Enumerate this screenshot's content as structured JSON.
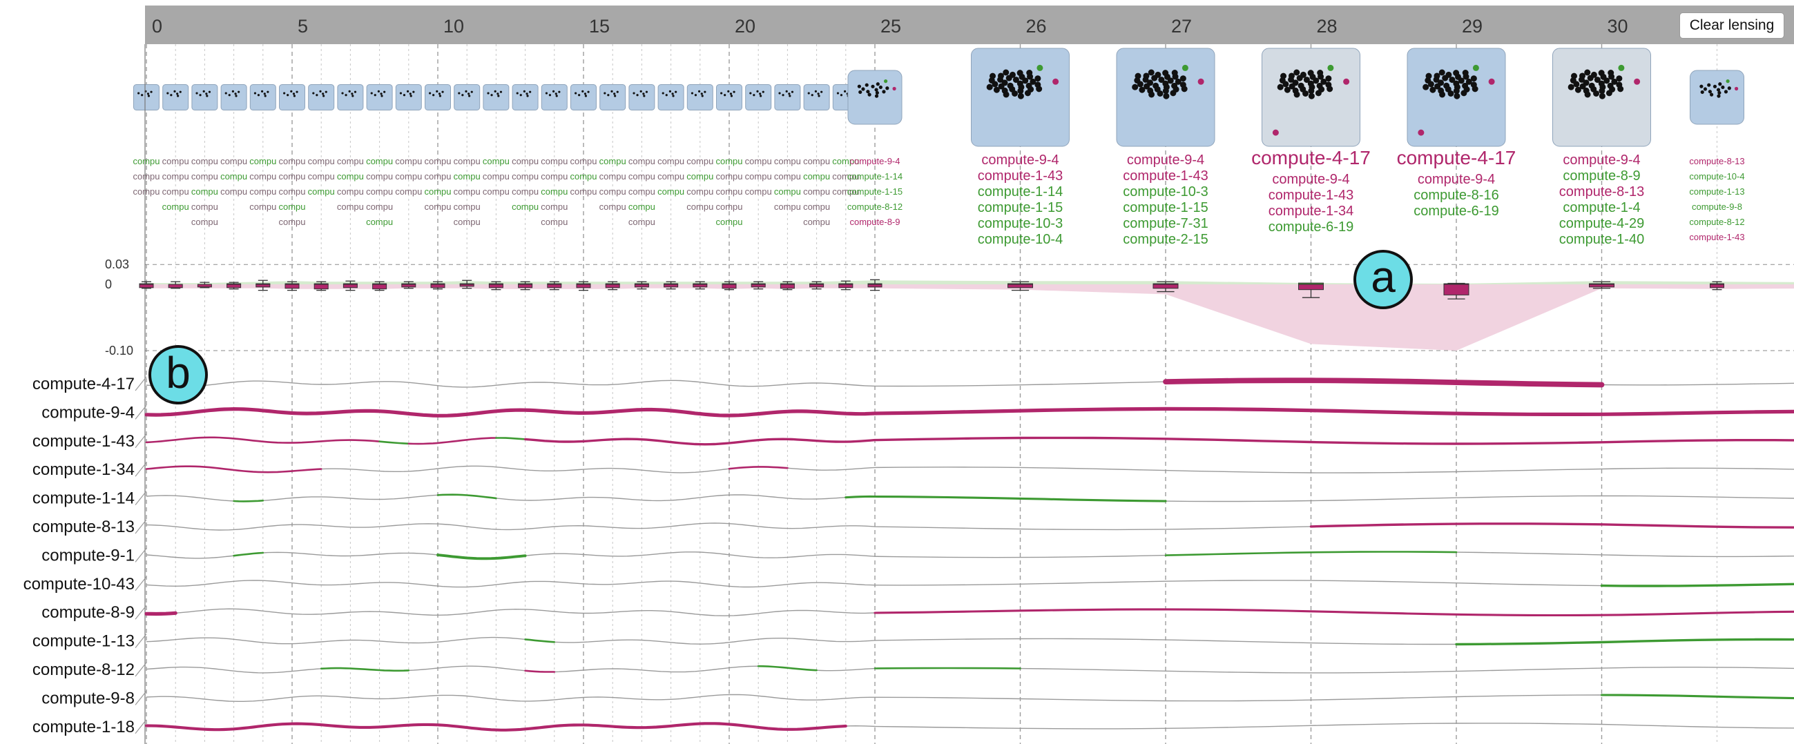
{
  "controls": {
    "clear_lensing_label": "Clear lensing"
  },
  "markers": {
    "a": "a",
    "b": "b"
  },
  "chart_data": {
    "type": "line",
    "x_axis_ticks": [
      0,
      5,
      10,
      15,
      20,
      25,
      26,
      27,
      28,
      29,
      30
    ],
    "y_axis_ticks": [
      "0.03",
      "0",
      "-0.10"
    ],
    "timesteps": [
      0,
      1,
      2,
      3,
      4,
      5,
      6,
      7,
      8,
      9,
      10,
      11,
      12,
      13,
      14,
      15,
      16,
      17,
      18,
      19,
      20,
      21,
      22,
      23,
      24,
      25,
      26,
      27,
      28,
      29,
      30,
      31,
      32
    ],
    "lens": [
      25,
      26,
      27,
      28,
      29,
      30
    ],
    "colors": {
      "positive": "#3d9a32",
      "negative": "#b0266b",
      "neutral": "#9a9a9a",
      "header": "#a8a8a8",
      "thumbnail": "#b4cbe3",
      "thumbnail_gray": "#d3dbe3"
    },
    "thumbnail_gray_steps": [
      28,
      30
    ],
    "top_labels": {
      "25": [
        {
          "text": "compute-9-4",
          "color": "negative",
          "size": "small"
        },
        {
          "text": "compute-1-14",
          "color": "positive",
          "size": "small"
        },
        {
          "text": "compute-1-15",
          "color": "positive",
          "size": "small"
        },
        {
          "text": "compute-8-12",
          "color": "positive",
          "size": "small"
        },
        {
          "text": "compute-8-9",
          "color": "negative",
          "size": "small"
        }
      ],
      "26": [
        {
          "text": "compute-9-4",
          "color": "negative",
          "size": "medium"
        },
        {
          "text": "compute-1-43",
          "color": "negative",
          "size": "medium"
        },
        {
          "text": "compute-1-14",
          "color": "positive",
          "size": "medium"
        },
        {
          "text": "compute-1-15",
          "color": "positive",
          "size": "medium"
        },
        {
          "text": "compute-10-3",
          "color": "positive",
          "size": "medium"
        },
        {
          "text": "compute-10-4",
          "color": "positive",
          "size": "medium"
        }
      ],
      "27": [
        {
          "text": "compute-9-4",
          "color": "negative",
          "size": "medium"
        },
        {
          "text": "compute-1-43",
          "color": "negative",
          "size": "medium"
        },
        {
          "text": "compute-10-3",
          "color": "positive",
          "size": "medium"
        },
        {
          "text": "compute-1-15",
          "color": "positive",
          "size": "medium"
        },
        {
          "text": "compute-7-31",
          "color": "positive",
          "size": "medium"
        },
        {
          "text": "compute-2-15",
          "color": "positive",
          "size": "medium"
        }
      ],
      "28": [
        {
          "text": "compute-4-17",
          "color": "negative",
          "size": "large"
        },
        {
          "text": "compute-9-4",
          "color": "negative",
          "size": "medium"
        },
        {
          "text": "compute-1-43",
          "color": "negative",
          "size": "medium"
        },
        {
          "text": "compute-1-34",
          "color": "negative",
          "size": "medium"
        },
        {
          "text": "compute-6-19",
          "color": "positive",
          "size": "medium"
        }
      ],
      "29": [
        {
          "text": "compute-4-17",
          "color": "negative",
          "size": "large"
        },
        {
          "text": "compute-9-4",
          "color": "negative",
          "size": "medium"
        },
        {
          "text": "compute-8-16",
          "color": "positive",
          "size": "medium"
        },
        {
          "text": "compute-6-19",
          "color": "positive",
          "size": "medium"
        }
      ],
      "30": [
        {
          "text": "compute-9-4",
          "color": "negative",
          "size": "medium"
        },
        {
          "text": "compute-8-9",
          "color": "positive",
          "size": "medium"
        },
        {
          "text": "compute-8-13",
          "color": "negative",
          "size": "medium"
        },
        {
          "text": "compute-1-4",
          "color": "positive",
          "size": "medium"
        },
        {
          "text": "compute-4-29",
          "color": "positive",
          "size": "medium"
        },
        {
          "text": "compute-1-40",
          "color": "positive",
          "size": "medium"
        }
      ],
      "31": [
        {
          "text": "compute-8-13",
          "color": "negative",
          "size": "small"
        },
        {
          "text": "compute-10-4",
          "color": "positive",
          "size": "small"
        },
        {
          "text": "compute-1-13",
          "color": "positive",
          "size": "small"
        },
        {
          "text": "compute-9-8",
          "color": "positive",
          "size": "small"
        },
        {
          "text": "compute-8-12",
          "color": "positive",
          "size": "small"
        },
        {
          "text": "compute-1-43",
          "color": "negative",
          "size": "small"
        }
      ],
      "32": [
        {
          "text": "compu",
          "color": "negative",
          "size": "small"
        },
        {
          "text": "compu",
          "color": "positive",
          "size": "small"
        },
        {
          "text": "compu",
          "color": "positive",
          "size": "small"
        },
        {
          "text": "compu",
          "color": "positive",
          "size": "small"
        },
        {
          "text": "compu",
          "color": "positive",
          "size": "small"
        },
        {
          "text": "compu",
          "color": "positive",
          "size": "small"
        }
      ]
    },
    "collapsed_label_text": "compu",
    "boxplots": [
      {
        "t": 0,
        "whisker_low": -0.006,
        "q1": -0.005,
        "q3": 0.001,
        "whisker_high": 0.004
      },
      {
        "t": 1,
        "whisker_low": -0.006,
        "q1": -0.005,
        "q3": 0.0,
        "whisker_high": 0.004
      },
      {
        "t": 2,
        "whisker_low": -0.005,
        "q1": -0.004,
        "q3": 0.0,
        "whisker_high": 0.003
      },
      {
        "t": 3,
        "whisker_low": -0.007,
        "q1": -0.005,
        "q3": 0.001,
        "whisker_high": 0.003
      },
      {
        "t": 4,
        "whisker_low": -0.009,
        "q1": -0.004,
        "q3": 0.001,
        "whisker_high": 0.006
      },
      {
        "t": 5,
        "whisker_low": -0.009,
        "q1": -0.006,
        "q3": 0.001,
        "whisker_high": 0.004
      },
      {
        "t": 6,
        "whisker_low": -0.009,
        "q1": -0.007,
        "q3": 0.001,
        "whisker_high": 0.004
      },
      {
        "t": 7,
        "whisker_low": -0.009,
        "q1": -0.005,
        "q3": 0.001,
        "whisker_high": 0.005
      },
      {
        "t": 8,
        "whisker_low": -0.009,
        "q1": -0.007,
        "q3": 0.001,
        "whisker_high": 0.004
      },
      {
        "t": 9,
        "whisker_low": -0.006,
        "q1": -0.004,
        "q3": 0.001,
        "whisker_high": 0.004
      },
      {
        "t": 10,
        "whisker_low": -0.007,
        "q1": -0.005,
        "q3": 0.001,
        "whisker_high": 0.004
      },
      {
        "t": 11,
        "whisker_low": -0.006,
        "q1": -0.003,
        "q3": 0.001,
        "whisker_high": 0.006
      },
      {
        "t": 12,
        "whisker_low": -0.008,
        "q1": -0.005,
        "q3": 0.001,
        "whisker_high": 0.004
      },
      {
        "t": 13,
        "whisker_low": -0.008,
        "q1": -0.005,
        "q3": 0.001,
        "whisker_high": 0.004
      },
      {
        "t": 14,
        "whisker_low": -0.008,
        "q1": -0.005,
        "q3": 0.001,
        "whisker_high": 0.004
      },
      {
        "t": 15,
        "whisker_low": -0.009,
        "q1": -0.005,
        "q3": 0.001,
        "whisker_high": 0.004
      },
      {
        "t": 16,
        "whisker_low": -0.008,
        "q1": -0.005,
        "q3": 0.001,
        "whisker_high": 0.004
      },
      {
        "t": 17,
        "whisker_low": -0.007,
        "q1": -0.004,
        "q3": 0.001,
        "whisker_high": 0.004
      },
      {
        "t": 18,
        "whisker_low": -0.007,
        "q1": -0.004,
        "q3": 0.001,
        "whisker_high": 0.004
      },
      {
        "t": 19,
        "whisker_low": -0.007,
        "q1": -0.004,
        "q3": 0.001,
        "whisker_high": 0.004
      },
      {
        "t": 20,
        "whisker_low": -0.008,
        "q1": -0.006,
        "q3": 0.001,
        "whisker_high": 0.004
      },
      {
        "t": 21,
        "whisker_low": -0.007,
        "q1": -0.004,
        "q3": 0.001,
        "whisker_high": 0.004
      },
      {
        "t": 22,
        "whisker_low": -0.008,
        "q1": -0.006,
        "q3": 0.001,
        "whisker_high": 0.004
      },
      {
        "t": 23,
        "whisker_low": -0.007,
        "q1": -0.004,
        "q3": 0.001,
        "whisker_high": 0.004
      },
      {
        "t": 24,
        "whisker_low": -0.008,
        "q1": -0.005,
        "q3": 0.001,
        "whisker_high": 0.005
      },
      {
        "t": 25,
        "whisker_low": -0.009,
        "q1": -0.004,
        "q3": 0.001,
        "whisker_high": 0.007
      },
      {
        "t": 26,
        "whisker_low": -0.009,
        "q1": -0.005,
        "q3": 0.001,
        "whisker_high": 0.004
      },
      {
        "t": 27,
        "whisker_low": -0.011,
        "q1": -0.006,
        "q3": 0.001,
        "whisker_high": 0.004
      },
      {
        "t": 28,
        "whisker_low": -0.02,
        "q1": -0.008,
        "q3": 0.002,
        "whisker_high": 0.0014
      },
      {
        "t": 29,
        "whisker_low": -0.022,
        "q1": -0.016,
        "q3": 0.001,
        "whisker_high": 0.0016
      },
      {
        "t": 30,
        "whisker_low": -0.006,
        "q1": -0.004,
        "q3": 0.001,
        "whisker_high": 0.004
      },
      {
        "t": 31,
        "whisker_low": -0.008,
        "q1": -0.005,
        "q3": 0.001,
        "whisker_high": 0.004
      },
      {
        "t": 32,
        "whisker_low": -0.006,
        "q1": -0.005,
        "q3": 0.001,
        "whisker_high": 0.004
      }
    ],
    "band_upper": [
      0.002,
      0.002,
      0.002,
      0.003,
      0.004,
      0.005,
      0.004,
      0.004,
      0.004,
      0.004,
      0.004,
      0.005,
      0.004,
      0.004,
      0.004,
      0.004,
      0.004,
      0.004,
      0.004,
      0.004,
      0.004,
      0.004,
      0.004,
      0.004,
      0.005,
      0.006,
      0.005,
      0.005,
      0.002,
      0.001,
      0.005,
      0.004,
      0.003
    ],
    "band_lower": [
      -0.006,
      -0.006,
      -0.006,
      -0.006,
      -0.006,
      -0.007,
      -0.007,
      -0.007,
      -0.007,
      -0.006,
      -0.006,
      -0.006,
      -0.007,
      -0.007,
      -0.007,
      -0.007,
      -0.007,
      -0.006,
      -0.006,
      -0.006,
      -0.007,
      -0.006,
      -0.007,
      -0.006,
      -0.006,
      -0.006,
      -0.008,
      -0.015,
      -0.09,
      -0.1,
      -0.006,
      -0.007,
      -0.006
    ],
    "series": [
      {
        "name": "compute-4-17",
        "segments": [
          [
            27,
            30,
            "negative",
            3
          ]
        ]
      },
      {
        "name": "compute-9-4",
        "segments": [
          [
            0,
            32,
            "negative",
            2
          ]
        ]
      },
      {
        "name": "compute-1-43",
        "segments": [
          [
            0,
            8,
            "negative",
            1
          ],
          [
            8,
            9,
            "positive",
            1
          ],
          [
            9,
            12,
            "negative",
            1
          ],
          [
            12,
            13,
            "positive",
            1
          ],
          [
            13,
            32,
            "negative",
            1.3
          ]
        ]
      },
      {
        "name": "compute-1-34",
        "segments": [
          [
            0,
            6,
            "negative",
            1
          ],
          [
            20,
            22,
            "negative",
            1
          ]
        ]
      },
      {
        "name": "compute-1-14",
        "segments": [
          [
            3,
            4,
            "positive",
            1
          ],
          [
            10,
            12,
            "positive",
            1
          ],
          [
            24,
            27,
            "positive",
            1.2
          ]
        ]
      },
      {
        "name": "compute-8-13",
        "segments": [
          [
            28,
            32,
            "negative",
            1.3
          ]
        ]
      },
      {
        "name": "compute-9-1",
        "segments": [
          [
            3,
            4,
            "positive",
            1
          ],
          [
            10,
            13,
            "positive",
            1.5
          ],
          [
            27,
            29,
            "positive",
            1
          ]
        ]
      },
      {
        "name": "compute-10-43",
        "segments": [
          [
            30,
            32,
            "positive",
            1.3
          ]
        ]
      },
      {
        "name": "compute-8-9",
        "segments": [
          [
            0,
            1,
            "negative",
            2
          ],
          [
            25,
            32,
            "negative",
            1.2
          ]
        ]
      },
      {
        "name": "compute-1-13",
        "segments": [
          [
            13,
            14,
            "positive",
            1
          ],
          [
            29,
            32,
            "positive",
            1.3
          ]
        ]
      },
      {
        "name": "compute-8-12",
        "segments": [
          [
            6,
            9,
            "positive",
            1
          ],
          [
            13,
            14,
            "negative",
            1
          ],
          [
            21,
            23,
            "positive",
            1
          ],
          [
            25,
            26,
            "positive",
            1
          ]
        ]
      },
      {
        "name": "compute-9-8",
        "segments": [
          [
            30,
            32,
            "positive",
            1.2
          ]
        ]
      },
      {
        "name": "compute-1-18",
        "segments": [
          [
            0,
            24,
            "negative",
            1.6
          ]
        ]
      }
    ]
  }
}
